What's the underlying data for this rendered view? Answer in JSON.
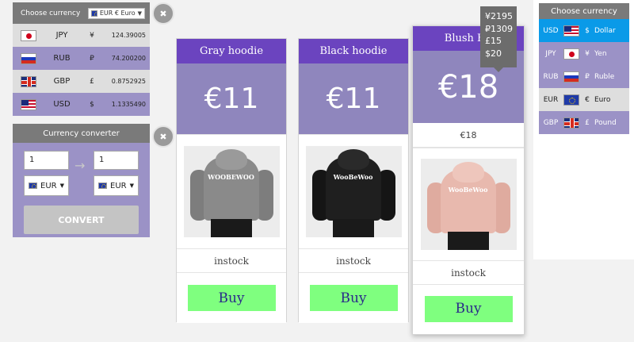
{
  "currency_table": {
    "title": "Choose currency",
    "selected": "EUR € Euro",
    "rows": [
      {
        "flag": "f-jpy",
        "code": "JPY",
        "symbol": "¥",
        "rate": "124.39005"
      },
      {
        "flag": "f-rub",
        "code": "RUB",
        "symbol": "₽",
        "rate": "74.200200"
      },
      {
        "flag": "f-gbp",
        "code": "GBP",
        "symbol": "£",
        "rate": "0.8752925"
      },
      {
        "flag": "f-usd",
        "code": "USD",
        "symbol": "$",
        "rate": "1.1335490"
      }
    ]
  },
  "close_icon": "✖",
  "converter": {
    "title": "Currency converter",
    "from_value": "1",
    "to_value": "1",
    "from_currency": "EUR",
    "to_currency": "EUR",
    "arrow": "→",
    "button": "CONVERT"
  },
  "products": [
    {
      "name": "Gray hoodie",
      "price": "€11",
      "stock": "instock",
      "buy": "Buy",
      "color": "#8a8a8a",
      "text": "WOOBEWOO",
      "text_color": "#ffffff"
    },
    {
      "name": "Black hoodie",
      "price": "€11",
      "stock": "instock",
      "buy": "Buy",
      "color": "#1f1f1f",
      "text": "WooBeWoo",
      "text_color": "#ffffff"
    },
    {
      "name": "Blush Hoodie",
      "name_visible": "Blush Ho",
      "price": "€18",
      "sub_price": "€18",
      "stock": "instock",
      "buy": "Buy",
      "color": "#e8b9ae",
      "text": "WooBeWoo",
      "text_color": "#ffffff"
    }
  ],
  "tooltip": [
    "¥2195",
    "₽1309",
    "£15",
    "$20"
  ],
  "right_selector": {
    "title": "Choose currency",
    "items": [
      {
        "code": "USD",
        "flag": "f-usd",
        "symbol": "$",
        "name": "Dollar"
      },
      {
        "code": "JPY",
        "flag": "f-jpy",
        "symbol": "¥",
        "name": "Yen"
      },
      {
        "code": "RUB",
        "flag": "f-rub",
        "symbol": "₽",
        "name": "Ruble"
      },
      {
        "code": "EUR",
        "flag": "f-eur",
        "symbol": "€",
        "name": "Euro"
      },
      {
        "code": "GBP",
        "flag": "f-gbp",
        "symbol": "£",
        "name": "Pound"
      }
    ]
  }
}
